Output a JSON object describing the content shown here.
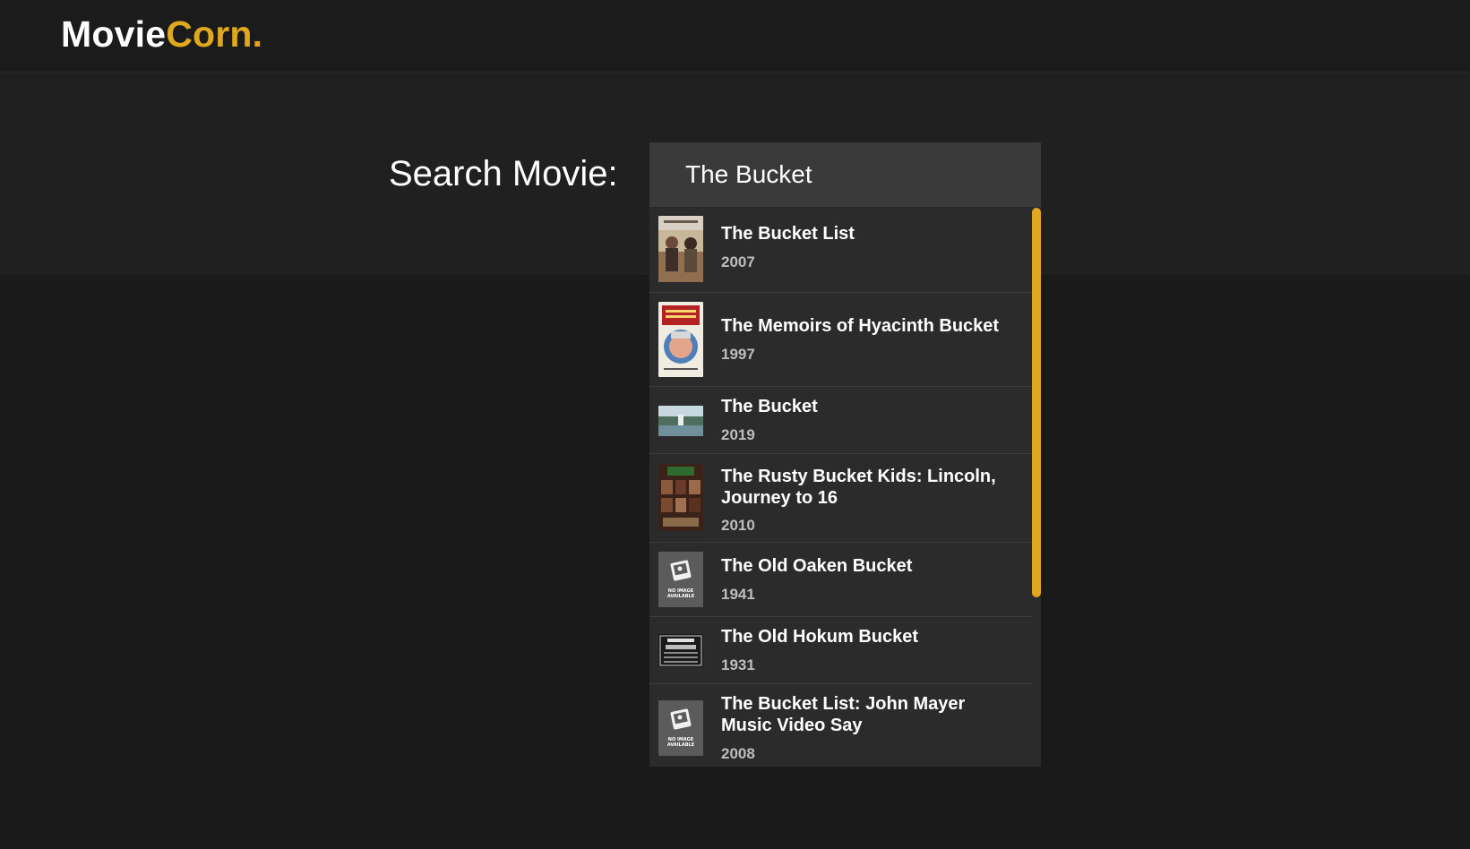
{
  "app": {
    "logo_part1": "Movie",
    "logo_part2": "Corn.",
    "accent_color": "#e0a81e"
  },
  "search": {
    "label": "Search Movie:",
    "value": "The Bucket"
  },
  "results": [
    {
      "title": "The Bucket List",
      "year": "2007",
      "thumb": "poster-bucket-list"
    },
    {
      "title": "The Memoirs of Hyacinth Bucket",
      "year": "1997",
      "thumb": "poster-hyacinth"
    },
    {
      "title": "The Bucket",
      "year": "2019",
      "thumb": "poster-the-bucket"
    },
    {
      "title": "The Rusty Bucket Kids: Lincoln, Journey to 16",
      "year": "2010",
      "thumb": "poster-rusty-bucket"
    },
    {
      "title": "The Old Oaken Bucket",
      "year": "1941",
      "thumb": "no-image-placeholder"
    },
    {
      "title": "The Old Hokum Bucket",
      "year": "1931",
      "thumb": "poster-old-hokum"
    },
    {
      "title": "The Bucket List: John Mayer Music Video Say",
      "year": "2008",
      "thumb": "no-image-placeholder"
    }
  ],
  "no_image_text": {
    "line1": "NO IMAGE",
    "line2": "AVAILABLE"
  }
}
